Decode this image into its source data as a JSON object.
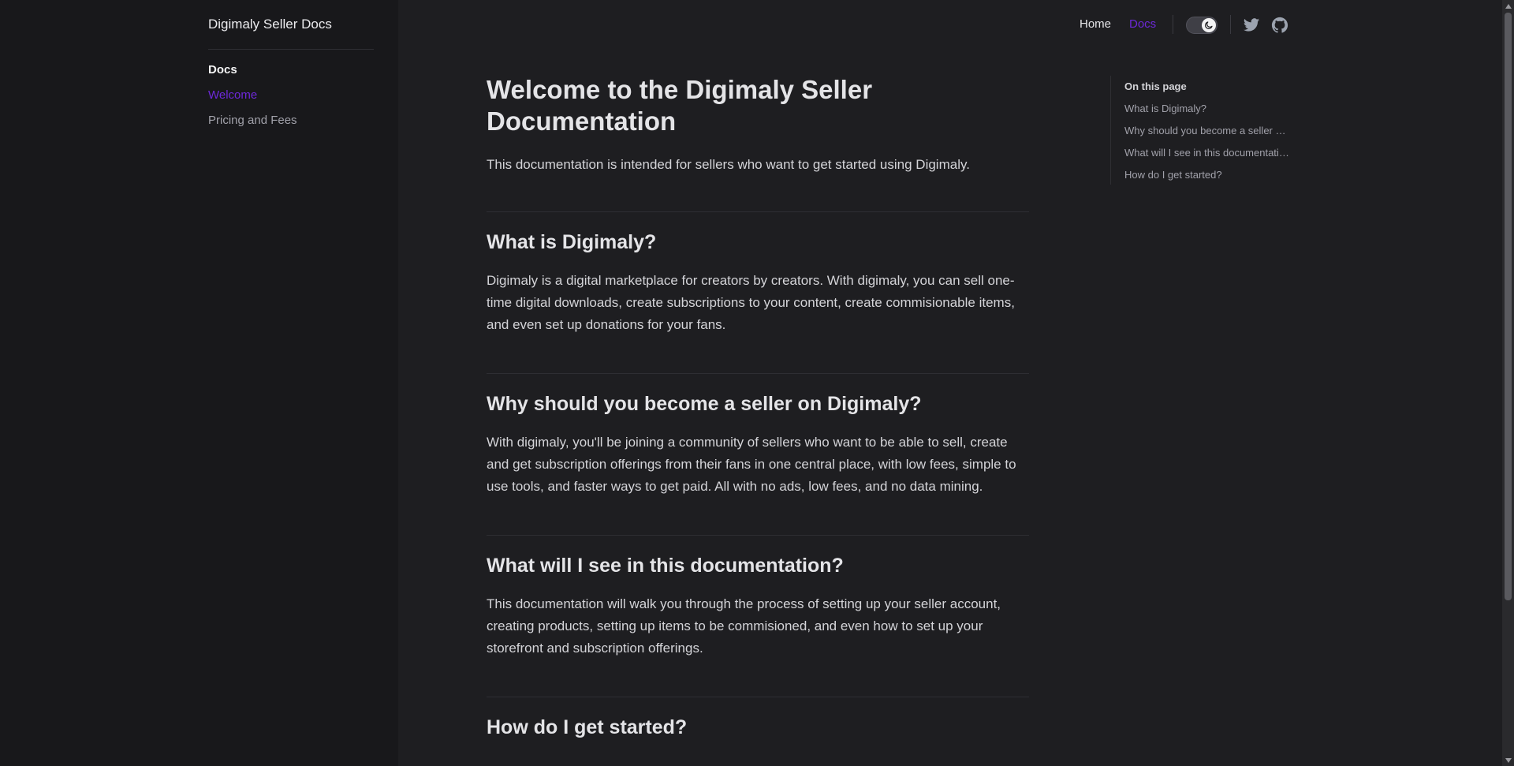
{
  "sidebar": {
    "site_title": "Digimaly Seller Docs",
    "section": "Docs",
    "items": [
      {
        "label": "Welcome",
        "active": true
      },
      {
        "label": "Pricing and Fees",
        "active": false
      }
    ]
  },
  "topnav": {
    "home": "Home",
    "docs": "Docs",
    "icons": [
      "theme-toggle-moon-icon",
      "twitter-icon",
      "github-icon"
    ]
  },
  "main": {
    "title": "Welcome to the Digimaly Seller Documentation",
    "intro": "This documentation is intended for sellers who want to get started using Digimaly.",
    "sections": [
      {
        "heading": "What is Digimaly?",
        "body": "Digimaly is a digital marketplace for creators by creators. With digimaly, you can sell one-time digital downloads, create subscriptions to your content, create commisionable items, and even set up donations for your fans."
      },
      {
        "heading": "Why should you become a seller on Digimaly?",
        "body": "With digimaly, you'll be joining a community of sellers who want to be able to sell, create and get subscription offerings from their fans in one central place, with low fees, simple to use tools, and faster ways to get paid. All with no ads, low fees, and no data mining."
      },
      {
        "heading": "What will I see in this documentation?",
        "body": "This documentation will walk you through the process of setting up your seller account, creating products, setting up items to be commisioned, and even how to set up your storefront and subscription offerings."
      },
      {
        "heading": "How do I get started?",
        "body": ""
      }
    ]
  },
  "toc": {
    "title": "On this page",
    "items": [
      "What is Digimaly?",
      "Why should you become a seller on Digimaly?",
      "What will I see in this documentation?",
      "How do I get started?"
    ]
  },
  "colors": {
    "accent": "#6d28d9",
    "background": "#1e1e21",
    "sidebar": "#18181b"
  }
}
